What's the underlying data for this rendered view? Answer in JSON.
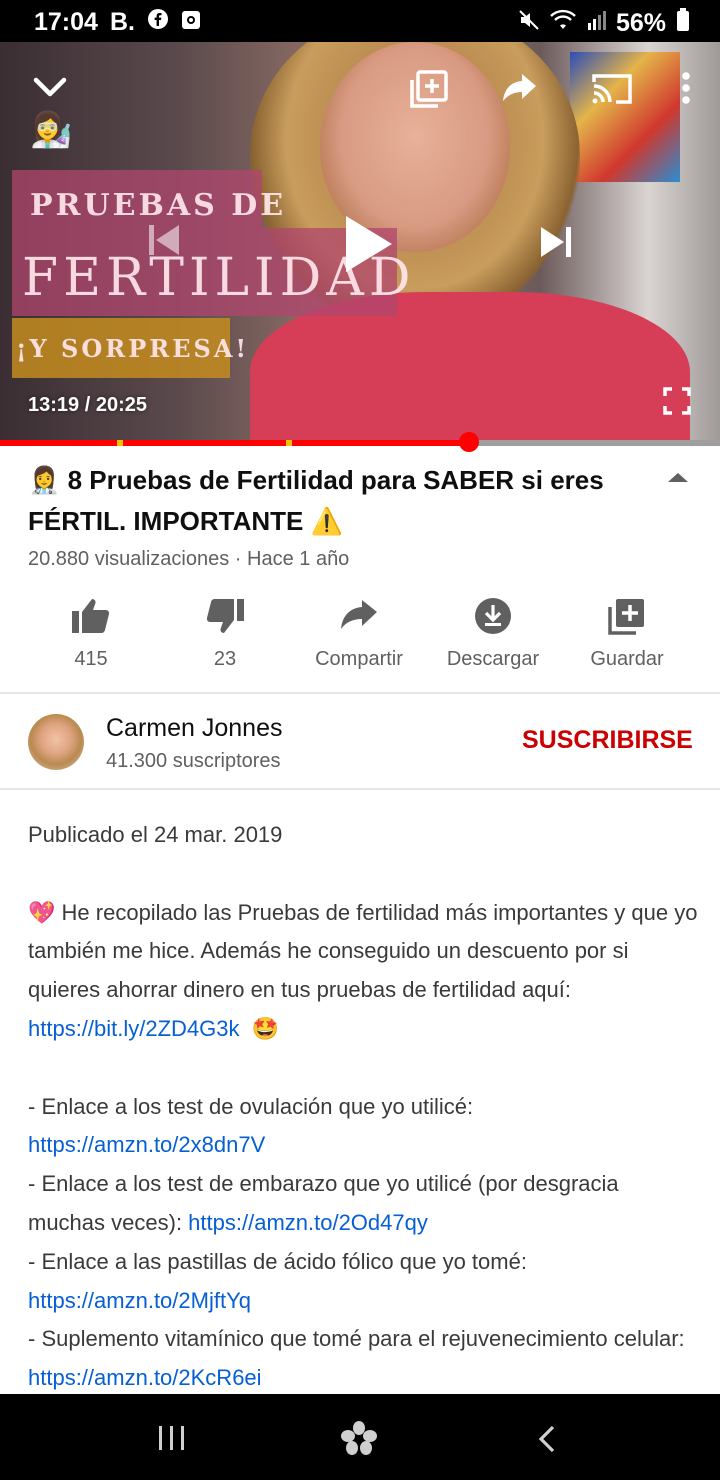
{
  "status_bar": {
    "time": "17:04",
    "left_icons": [
      "B.",
      "facebook-icon",
      "camera-icon"
    ],
    "battery": "56%",
    "right_icons": [
      "mute-icon",
      "wifi-icon",
      "signal-icon",
      "battery-icon"
    ]
  },
  "player": {
    "thumbnail_text": {
      "line1": "PRUEBAS DE",
      "line2": "FERTILIDAD",
      "line3": "¡Y SORPRESA!"
    },
    "current_time": "13:19",
    "duration": "20:25",
    "time_display": "13:19 / 20:25",
    "progress_fraction": 0.651,
    "chapter_markers_fraction": [
      0.163,
      0.397
    ],
    "controls": [
      "collapse-icon",
      "add-to-playlist-icon",
      "share-icon",
      "cast-icon",
      "more-icon",
      "previous-icon",
      "play-icon",
      "next-icon",
      "fullscreen-icon"
    ]
  },
  "video": {
    "title_emoji": "👩‍⚕️",
    "title": "8 Pruebas de Fertilidad para SABER si eres FÉRTIL. IMPORTANTE",
    "title_warning": "⚠️",
    "views": "20.880 visualizaciones · Hace 1 año"
  },
  "actions": [
    {
      "name": "like",
      "label": "415"
    },
    {
      "name": "dislike",
      "label": "23"
    },
    {
      "name": "share",
      "label": "Compartir"
    },
    {
      "name": "download",
      "label": "Descargar"
    },
    {
      "name": "save",
      "label": "Guardar"
    }
  ],
  "channel": {
    "name": "Carmen Jonnes",
    "subscribers": "41.300 suscriptores",
    "subscribe_label": "SUSCRIBIRSE"
  },
  "description": {
    "published": "Publicado el 24 mar. 2019",
    "intro_emoji": "💖",
    "intro": "He recopilado las Pruebas de fertilidad más importantes y que yo también me hice. Además he conseguido un descuento por si quieres ahorrar dinero en tus pruebas de fertilidad aquí: ",
    "intro_link": "https://bit.ly/2ZD4G3k",
    "intro_end_emoji": "🤩",
    "item1_text": "- Enlace a los test de ovulación que yo utilicé: ",
    "item1_link": "https://amzn.to/2x8dn7V",
    "item2_text": "- Enlace a los test de embarazo que yo utilicé (por desgracia muchas veces): ",
    "item2_link": "https://amzn.to/2Od47qy",
    "item3_text": "- Enlace a las pastillas de ácido fólico que yo tomé: ",
    "item3_link": "https://amzn.to/2MjftYq",
    "item4_text": "- Suplemento vitamínico que tomé para el rejuvenecimiento celular: ",
    "item4_link": "https://amzn.to/2KcR6ei"
  },
  "nav_bar": [
    "recents-icon",
    "home-icon",
    "back-icon"
  ],
  "colors": {
    "accent_red": "#ff0000",
    "subscribe_red": "#cc0000",
    "link_blue": "#065fd4",
    "secondary_text": "#606060"
  }
}
